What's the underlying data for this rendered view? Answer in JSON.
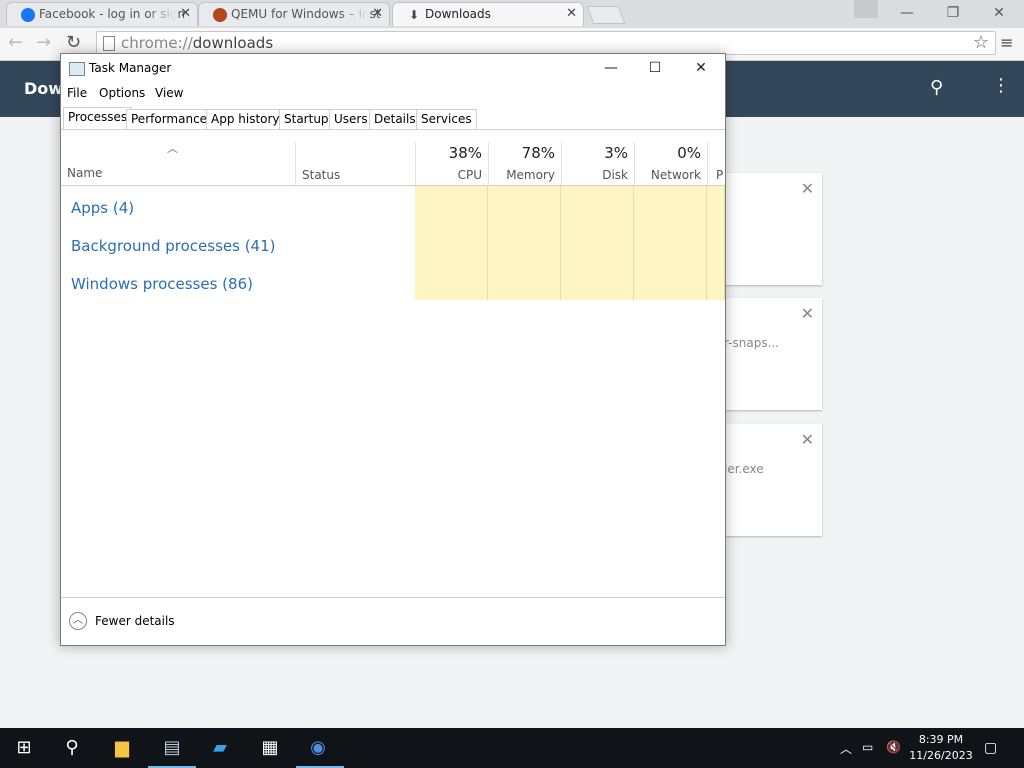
{
  "browser": {
    "tabs": [
      {
        "title": "Facebook - log in or sign",
        "favicon_color": "#1877f2"
      },
      {
        "title": "QEMU for Windows – Inst",
        "favicon_color": "#b5461f"
      },
      {
        "title": "Downloads",
        "favicon_color": "#444444"
      }
    ],
    "url_scheme": "chrome://",
    "url_path": "downloads"
  },
  "downloads_page": {
    "title": "Down",
    "cards": [
      {
        "filename": ""
      },
      {
        "filename": "r-snaps..."
      },
      {
        "filename": "ler.exe"
      }
    ]
  },
  "task_manager": {
    "title": "Task Manager",
    "menu": [
      "File",
      "Options",
      "View"
    ],
    "tabs": [
      "Processes",
      "Performance",
      "App history",
      "Startup",
      "Users",
      "Details",
      "Services"
    ],
    "active_tab": "Processes",
    "columns": {
      "name": "Name",
      "status": "Status",
      "cpu": {
        "pct": "38%",
        "label": "CPU"
      },
      "memory": {
        "pct": "78%",
        "label": "Memory"
      },
      "disk": {
        "pct": "3%",
        "label": "Disk"
      },
      "network": {
        "pct": "0%",
        "label": "Network"
      },
      "power": {
        "label": "P"
      }
    },
    "groups": [
      "Apps (4)",
      "Background processes (41)",
      "Windows processes (86)"
    ],
    "fewer_details": "Fewer details"
  },
  "taskbar": {
    "time": "8:39 PM",
    "date": "11/26/2023"
  }
}
